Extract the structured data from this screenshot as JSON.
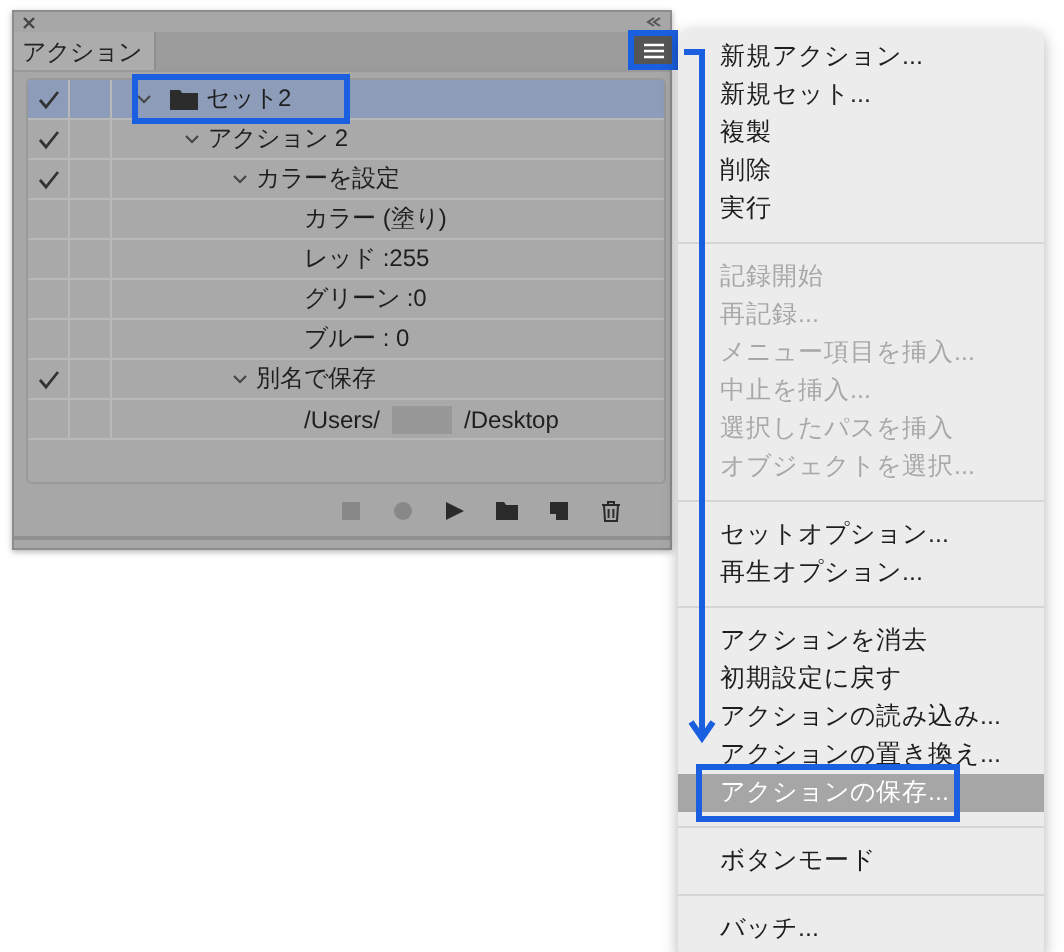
{
  "panel": {
    "tab": {
      "label": "アクション",
      "selected": true
    },
    "menu_button": {
      "highlighted": true
    },
    "tree": [
      {
        "label": "セット2",
        "kind": "set",
        "checked": true,
        "expanded": true,
        "selected": true,
        "highlighted": true,
        "children": [
          {
            "label": "アクション 2",
            "checked": true,
            "expanded": true,
            "selected": false,
            "children": [
              {
                "label": "カラーを設定",
                "checked": true,
                "expanded": true,
                "selected": false,
                "children": [
                  {
                    "label": "カラー (塗り)",
                    "checked": false,
                    "selected": false
                  },
                  {
                    "label": "レッド :255",
                    "checked": false,
                    "selected": false
                  },
                  {
                    "label": "グリーン :0",
                    "checked": false,
                    "selected": false
                  },
                  {
                    "label": "ブルー : 0",
                    "checked": false,
                    "selected": false
                  }
                ]
              },
              {
                "label": "別名で保存",
                "checked": true,
                "expanded": true,
                "selected": false,
                "children": [
                  {
                    "label_parts": [
                      "/Users/",
                      "/Desktop"
                    ],
                    "redacted": true,
                    "checked": false,
                    "selected": false
                  }
                ]
              }
            ]
          }
        ]
      }
    ],
    "toolbar": [
      {
        "kind": "stop",
        "disabled": true
      },
      {
        "kind": "record",
        "disabled": true
      },
      {
        "kind": "play",
        "disabled": false
      },
      {
        "kind": "folder",
        "disabled": false
      },
      {
        "kind": "new",
        "disabled": false
      },
      {
        "kind": "trash",
        "disabled": false
      }
    ]
  },
  "menu": {
    "groups": [
      [
        {
          "label": "新規アクション...",
          "disabled": false,
          "selected": false
        },
        {
          "label": "新規セット...",
          "disabled": false,
          "selected": false
        },
        {
          "label": "複製",
          "disabled": false,
          "selected": false
        },
        {
          "label": "削除",
          "disabled": false,
          "selected": false
        },
        {
          "label": "実行",
          "disabled": false,
          "selected": false
        }
      ],
      [
        {
          "label": "記録開始",
          "disabled": true,
          "selected": false
        },
        {
          "label": "再記録...",
          "disabled": true,
          "selected": false
        },
        {
          "label": "メニュー項目を挿入...",
          "disabled": true,
          "selected": false
        },
        {
          "label": "中止を挿入...",
          "disabled": true,
          "selected": false
        },
        {
          "label": "選択したパスを挿入",
          "disabled": true,
          "selected": false
        },
        {
          "label": "オブジェクトを選択...",
          "disabled": true,
          "selected": false
        }
      ],
      [
        {
          "label": "セットオプション...",
          "disabled": false,
          "selected": false
        },
        {
          "label": "再生オプション...",
          "disabled": false,
          "selected": false
        }
      ],
      [
        {
          "label": "アクションを消去",
          "disabled": false,
          "selected": false
        },
        {
          "label": "初期設定に戻す",
          "disabled": false,
          "selected": false
        },
        {
          "label": "アクションの読み込み...",
          "disabled": false,
          "selected": false
        },
        {
          "label": "アクションの置き換え...",
          "disabled": false,
          "selected": false
        },
        {
          "label": "アクションの保存...",
          "disabled": false,
          "selected": true,
          "highlighted": true
        }
      ],
      [
        {
          "label": "ボタンモード",
          "disabled": false,
          "selected": false
        }
      ],
      [
        {
          "label": "バッチ...",
          "disabled": false,
          "selected": false
        }
      ]
    ]
  }
}
